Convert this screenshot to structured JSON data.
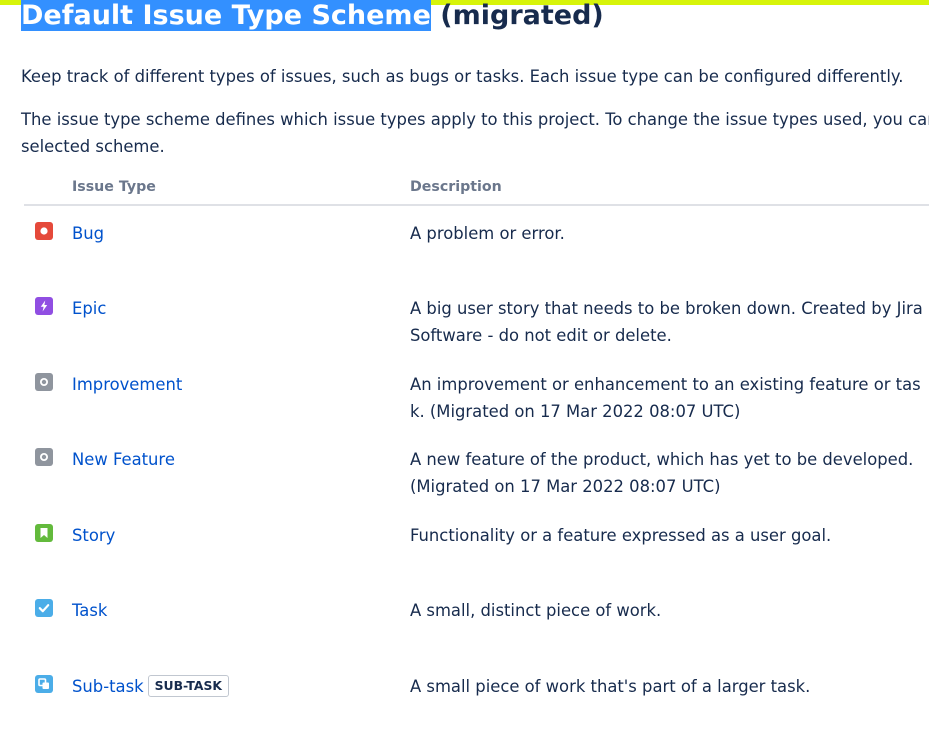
{
  "header": {
    "title_highlighted": "Default Issue Type Scheme",
    "title_rest": " (migrated)"
  },
  "intro": {
    "line1": "Keep track of different types of issues, such as bugs or tasks. Each issue type can be configured differently.",
    "line2": "The issue type scheme defines which issue types apply to this project. To change the issue types used, you car",
    "line3": "selected scheme."
  },
  "table": {
    "columns": [
      "Issue Type",
      "Description"
    ],
    "rows": [
      {
        "name": "Bug",
        "icon": "bug-icon",
        "color": "#e5493a",
        "description": "A problem or error."
      },
      {
        "name": "Epic",
        "icon": "epic-icon",
        "color": "#904ee2",
        "description": "A big user story that needs to be broken down. Created by Jira\nSoftware - do not edit or delete."
      },
      {
        "name": "Improvement",
        "icon": "improvement-icon",
        "color": "#8f959e",
        "description": "An improvement or enhancement to an existing feature or tas\nk. (Migrated on 17 Mar 2022 08:07 UTC)"
      },
      {
        "name": "New Feature",
        "icon": "new-feature-icon",
        "color": "#8f959e",
        "description": "A new feature of the product, which has yet to be developed.\n(Migrated on 17 Mar 2022 08:07 UTC)"
      },
      {
        "name": "Story",
        "icon": "story-icon",
        "color": "#63ba3c",
        "description": "Functionality or a feature expressed as a user goal."
      },
      {
        "name": "Task",
        "icon": "task-icon",
        "color": "#4bade8",
        "description": "A small, distinct piece of work."
      },
      {
        "name": "Sub-task",
        "icon": "subtask-icon",
        "color": "#4bade8",
        "badge": "SUB-TASK",
        "description": "A small piece of work that's part of a larger task."
      }
    ]
  },
  "colors": {
    "link": "#0052cc",
    "text": "#172b4d",
    "muted": "#6b778c",
    "selection": "#3390ff",
    "top_bar": "#d7f40a"
  }
}
